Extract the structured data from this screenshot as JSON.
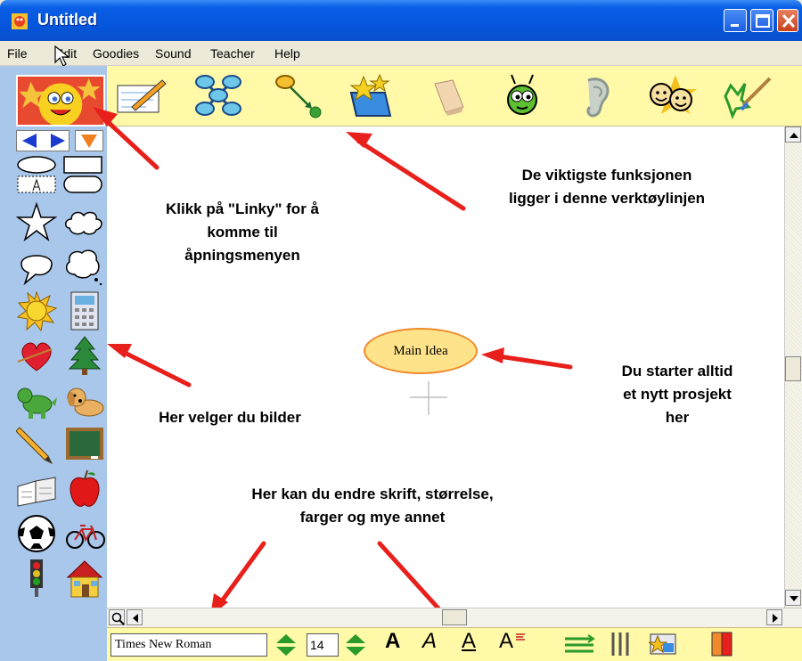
{
  "window": {
    "title": "Untitled"
  },
  "menu": [
    {
      "label": "File"
    },
    {
      "label": "Edit"
    },
    {
      "label": "Goodies"
    },
    {
      "label": "Sound"
    },
    {
      "label": "Teacher"
    },
    {
      "label": "Help"
    }
  ],
  "toolbar": {
    "tools": [
      "notes-icon",
      "rapid-create-icon",
      "link-icon",
      "symbol-box-icon",
      "eraser-icon",
      "bug-icon",
      "ear-icon",
      "faces-icon",
      "paintbrush-icon"
    ]
  },
  "palette": {
    "controls": [
      "arrow-left-icon",
      "arrow-right-icon",
      "dropdown-icon"
    ],
    "symbols": [
      "ellipse-shape",
      "rectangle-shape",
      "text-box-shape",
      "rounded-rect-shape",
      "star-shape",
      "cloud-shape",
      "speech-bubble-shape",
      "thought-bubble-shape",
      "sun-icon",
      "calculator-icon",
      "heart-icon",
      "tree-icon",
      "dinosaur-icon",
      "dog-icon",
      "pencil-icon",
      "chalkboard-icon",
      "book-icon",
      "apple-icon",
      "soccer-ball-icon",
      "bicycle-icon",
      "traffic-light-icon",
      "house-icon"
    ]
  },
  "canvas": {
    "main_idea": "Main Idea"
  },
  "annotations": {
    "linky": [
      "Klikk på \"Linky\" for å",
      "komme til",
      "åpningsmenyen"
    ],
    "toolbar": [
      "De viktigste funksjonen",
      "ligger i denne verktøylinjen"
    ],
    "start": [
      "Du starter alltid",
      "et nytt prosjekt",
      "her"
    ],
    "images": [
      "Her velger du bilder"
    ],
    "format": [
      "Her kan du endre skrift, størrelse,",
      "farger og mye annet"
    ]
  },
  "formatbar": {
    "font_name": "Times New Roman",
    "font_size": "14",
    "bold": "A",
    "italic": "A",
    "underline": "A",
    "text_color": "A"
  },
  "colors": {
    "titlebar": "#0556DC",
    "toolbar": "#FFF9A8",
    "palette": "#A9C7EA",
    "arrow": "#E8201C",
    "main_idea_fill": "#FFE38A"
  }
}
